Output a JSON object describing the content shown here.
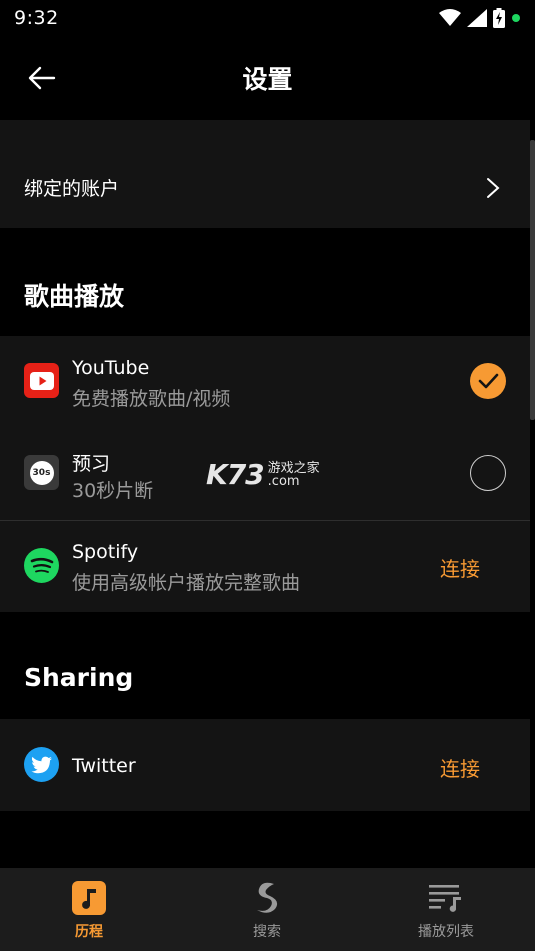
{
  "status_bar": {
    "time": "9:32"
  },
  "app_bar": {
    "title": "设置"
  },
  "linked_accounts": {
    "label": "绑定的账户"
  },
  "section_playback": {
    "title": "歌曲播放"
  },
  "playback_options": [
    {
      "name": "YouTube",
      "subtitle": "免费播放歌曲/视频",
      "selected": true,
      "icon": "youtube-icon"
    },
    {
      "name": "预习",
      "subtitle": "30秒片断",
      "selected": false,
      "icon": "preview-30s-icon",
      "icon_text": "30s"
    }
  ],
  "spotify": {
    "name": "Spotify",
    "subtitle": "使用高级帐户播放完整歌曲",
    "action": "连接",
    "icon": "spotify-icon"
  },
  "section_sharing": {
    "title": "Sharing"
  },
  "twitter": {
    "name": "Twitter",
    "action": "连接",
    "icon": "twitter-icon"
  },
  "watermark": {
    "brand": "K73",
    "cn": "游戏之家",
    "domain": ".com"
  },
  "bottom_nav": [
    {
      "label": "历程",
      "icon": "music-note-icon",
      "active": true
    },
    {
      "label": "搜索",
      "icon": "soundhound-icon",
      "active": false
    },
    {
      "label": "播放列表",
      "icon": "playlist-icon",
      "active": false
    }
  ],
  "colors": {
    "accent": "#f79a33",
    "background": "#000000",
    "row": "#141414",
    "youtube": "#e62117",
    "spotify": "#1ed760",
    "twitter": "#1da1f2"
  }
}
